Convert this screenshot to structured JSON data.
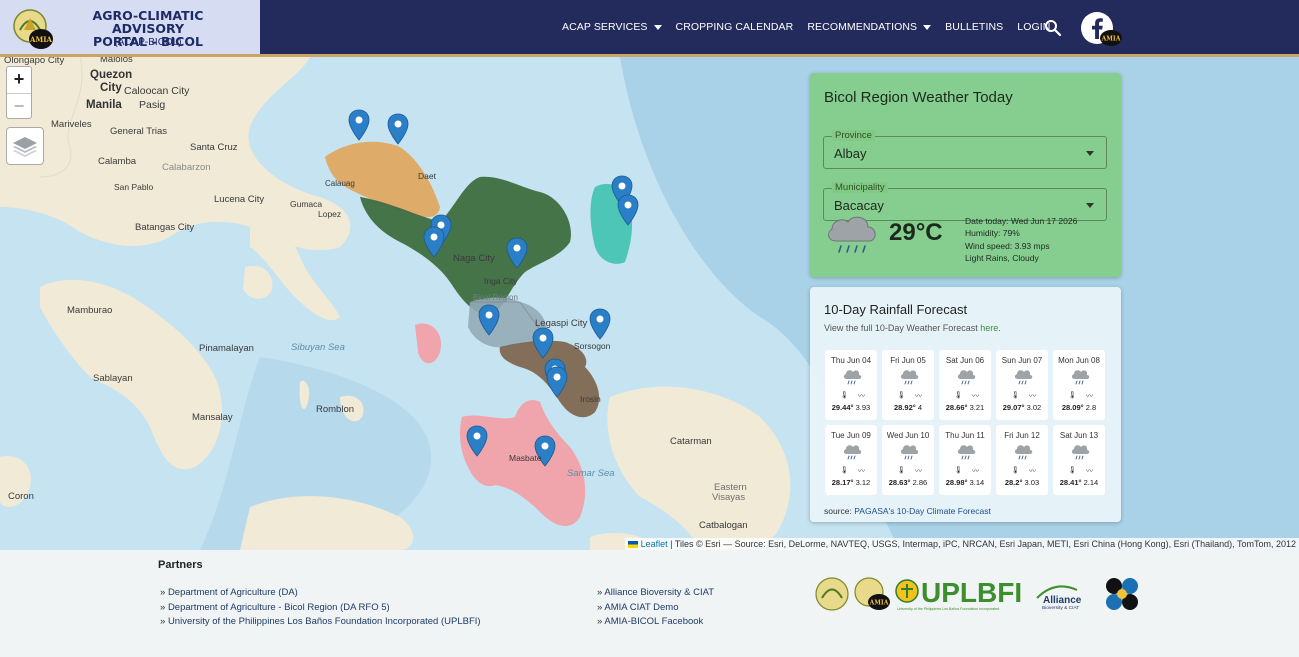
{
  "brand": {
    "title_line1": "AGRO-CLIMATIC ADVISORY",
    "title_line2": "PORTAL - BICOL",
    "subtitle": "(ACAP-BICOL)",
    "logo_icon": "da-bicol-amia-logo"
  },
  "nav": {
    "items": [
      {
        "label": "ACAP SERVICES",
        "dropdown": true
      },
      {
        "label": "CROPPING CALENDAR",
        "dropdown": false
      },
      {
        "label": "RECOMMENDATIONS",
        "dropdown": true
      },
      {
        "label": "BULLETINS",
        "dropdown": false
      },
      {
        "label": "LOGIN",
        "dropdown": false
      }
    ],
    "search_icon": "search-icon",
    "social_icon": "facebook-icon"
  },
  "map": {
    "zoom_in": "+",
    "zoom_out": "−",
    "layers_icon": "layers-icon",
    "places": [
      "Olongapo City",
      "Malolos",
      "Quezon",
      "City",
      "Caloocan City",
      "Manila",
      "Pasig",
      "Mariveles",
      "General Trias",
      "Santa Cruz",
      "Calamba",
      "Calabarzon",
      "San Pablo",
      "Lucena City",
      "Gumaca",
      "Lopez",
      "Batangas City",
      "Calauag",
      "Daet",
      "Naga City",
      "Iriga City",
      "Bicol Region",
      "Legaspi City",
      "Sorsogon",
      "Irosin",
      "Masbate",
      "Mamburao",
      "Pinamalayan",
      "Sibuyan Sea",
      "Sablayan",
      "Romblon",
      "Mansalay",
      "Samar Sea",
      "Catarman",
      "Eastern",
      "Visayas",
      "Catbalogan",
      "Coron"
    ],
    "attribution_leaflet": "Leaflet",
    "attribution_text": "| Tiles © Esri — Source: Esri, DeLorme, NAVTEQ, USGS, Intermap, iPC, NRCAN, Esri Japan, METI, Esri China (Hong Kong), Esri (Thailand), TomTom, 2012",
    "colors": {
      "water": "#c5e3f1",
      "land": "#f1ead7",
      "camarines_norte": "#e0a45a",
      "camarines_sur": "#3f6e3f",
      "catanduanes": "#3fc1b0",
      "albay": "#93aab7",
      "sorsogon": "#7a6048",
      "masbate": "#f2a0a8",
      "marker": "#2a7fc6"
    }
  },
  "weather": {
    "title": "Bicol Region Weather Today",
    "province_label": "Province",
    "province_value": "Albay",
    "municipality_label": "Municipality",
    "municipality_value": "Bacacay",
    "temperature": "29°C",
    "icon": "rain-cloud-icon",
    "date": "Date today: Wed Jun 17 2026",
    "humidity": "Humidity: 79%",
    "wind": "Wind speed: 3.93 mps",
    "condition": "Light Rains, Cloudy"
  },
  "forecast": {
    "title": "10-Day Rainfall Forecast",
    "link_prefix": "View the full 10-Day Weather Forecast",
    "link_text": "here",
    "link_suffix": ".",
    "days": [
      {
        "date": "Thu Jun 04",
        "temp": "29.44°",
        "wind": "3.93"
      },
      {
        "date": "Fri Jun 05",
        "temp": "28.92°",
        "wind": "4"
      },
      {
        "date": "Sat Jun 06",
        "temp": "28.66°",
        "wind": "3.21"
      },
      {
        "date": "Sun Jun 07",
        "temp": "29.07°",
        "wind": "3.02"
      },
      {
        "date": "Mon Jun 08",
        "temp": "28.09°",
        "wind": "2.8"
      },
      {
        "date": "Tue Jun 09",
        "temp": "28.17°",
        "wind": "3.12"
      },
      {
        "date": "Wed Jun 10",
        "temp": "28.63°",
        "wind": "2.86"
      },
      {
        "date": "Thu Jun 11",
        "temp": "28.98°",
        "wind": "3.14"
      },
      {
        "date": "Fri Jun 12",
        "temp": "28.2°",
        "wind": "3.03"
      },
      {
        "date": "Sat Jun 13",
        "temp": "28.41°",
        "wind": "2.14"
      }
    ],
    "source_prefix": "source:",
    "source_link": "PAGASA's 10-Day Climate Forecast"
  },
  "footer": {
    "partners_title": "Partners",
    "left_links": [
      "Department of Agriculture (DA)",
      "Department of Agriculture - Bicol Region (DA RFO 5)",
      "University of the Philippines Los Baños Foundation Incorporated (UPLBFI)"
    ],
    "right_links": [
      "Alliance Bioversity & CIAT",
      "AMIA CIAT Demo",
      "AMIA-BICOL Facebook"
    ],
    "logos": {
      "uplbfi": "UPLBFI",
      "uplbfi_sub": "University of the Philippines Los Baños Foundation Incorporated",
      "alliance": "Alliance",
      "alliance_sub": "Bioversity & CIAT"
    }
  }
}
